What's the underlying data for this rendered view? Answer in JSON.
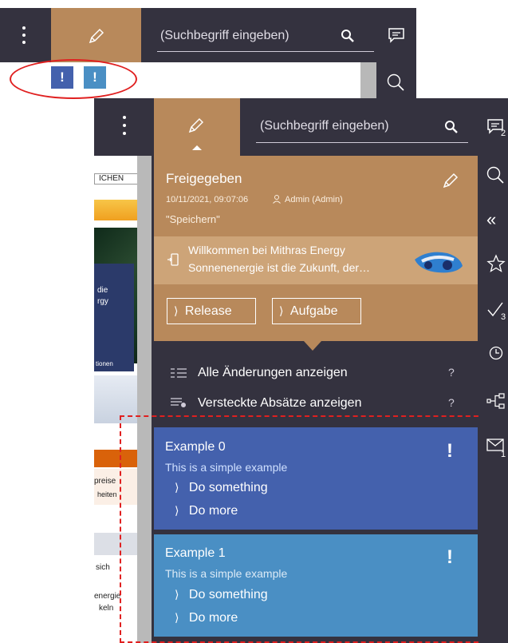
{
  "top_toolbar": {
    "search_placeholder": "(Suchbegriff eingeben)",
    "badge_left": "!",
    "badge_right": "!"
  },
  "panel": {
    "search_placeholder": "(Suchbegriff eingeben)",
    "header": {
      "status": "Freigegeben",
      "datetime": "10/11/2021, 09:07:06",
      "user": "Admin (Admin)",
      "comment": "\"Speichern\""
    },
    "page_item": {
      "line1": "Willkommen bei Mithras Energy",
      "line2": "Sonnenenergie ist die Zukunft, der…"
    },
    "buttons": {
      "release": "Release",
      "task": "Aufgabe"
    },
    "options": [
      {
        "label": "Alle Änderungen anzeigen",
        "help": "?"
      },
      {
        "label": "Versteckte Absätze anzeigen",
        "help": "?"
      }
    ],
    "cards": [
      {
        "title": "Example 0",
        "subtitle": "This is a simple example",
        "mark": "!",
        "actions": [
          "Do something",
          "Do more"
        ],
        "color": "#4461ad"
      },
      {
        "title": "Example 1",
        "subtitle": "This is a simple example",
        "mark": "!",
        "actions": [
          "Do something",
          "Do more"
        ],
        "color": "#4a8fc4"
      }
    ]
  },
  "side_rail": {
    "badges": [
      "2",
      "3",
      "1"
    ]
  },
  "background_site": {
    "nav_text": "ICHEN",
    "snippets": [
      "die",
      "rgy",
      "tionen",
      "preise",
      "heiten",
      "sich",
      "energie",
      "keln"
    ]
  }
}
